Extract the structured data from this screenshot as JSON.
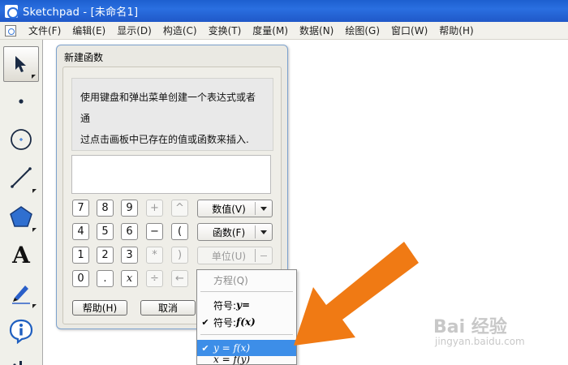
{
  "window": {
    "title": "Sketchpad  - [未命名1]"
  },
  "menu": [
    "文件(F)",
    "编辑(E)",
    "显示(D)",
    "构造(C)",
    "变换(T)",
    "度量(M)",
    "数据(N)",
    "绘图(G)",
    "窗口(W)",
    "帮助(H)"
  ],
  "toolbox": {
    "tools": [
      {
        "name": "arrow-select-icon",
        "selected": true
      },
      {
        "name": "point-tool-icon"
      },
      {
        "name": "compass-tool-icon"
      },
      {
        "name": "straightedge-tool-icon"
      },
      {
        "name": "polygon-tool-icon"
      },
      {
        "name": "text-tool-icon",
        "glyph": "A"
      },
      {
        "name": "marker-tool-icon"
      },
      {
        "name": "information-tool-icon",
        "glyph": "i"
      }
    ]
  },
  "dialog": {
    "title": "新建函数",
    "hint_line1": "使用键盘和弹出菜单创建一个表达式或者通",
    "hint_line2": "过点击画板中已存在的值或函数来插入.",
    "keypad": {
      "row1": [
        "7",
        "8",
        "9",
        "+",
        "^"
      ],
      "row2": [
        "4",
        "5",
        "6",
        "−",
        "("
      ],
      "row3": [
        "1",
        "2",
        "3",
        "*",
        ")"
      ],
      "row4": [
        "0",
        ".",
        "x",
        "÷",
        "←"
      ]
    },
    "value_button": "数值(V)",
    "function_button": "函数(F)",
    "unit_button": "单位(U)",
    "help_button": "帮助(H)",
    "cancel_button": "取消"
  },
  "popup_menu": {
    "equation": "方程(Q)",
    "symbol_y_label": "符号: ",
    "symbol_y_value": "y=",
    "symbol_fx_label": "符号: ",
    "symbol_fx_value": "f(x)",
    "y_eq_fx": "y = f(x)",
    "x_eq_fy": "x = f(y)"
  },
  "watermark": {
    "main": "Bai 经验",
    "sub": "jingyan.baidu.com"
  },
  "colors": {
    "title_bar": "#2a6fe0",
    "highlight": "#3d8ee8",
    "arrow": "#f07a14"
  }
}
